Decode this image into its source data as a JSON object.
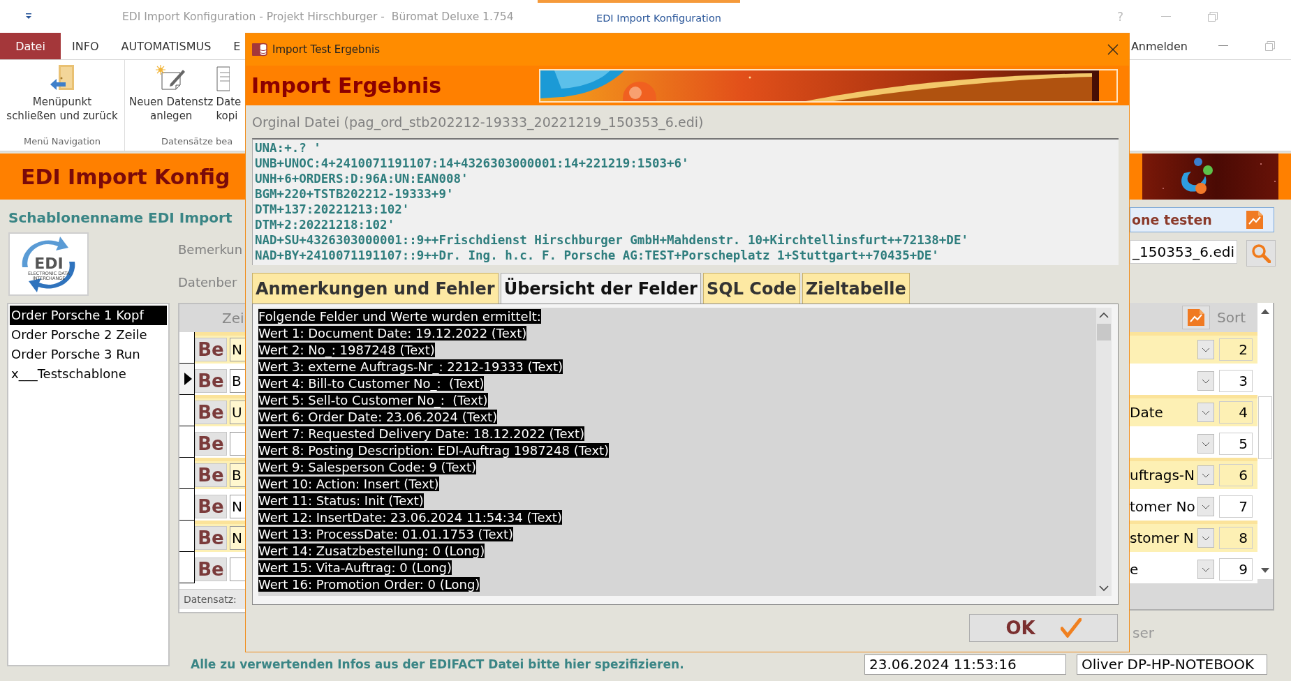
{
  "app": {
    "title": "EDI Import Konfiguration - Projekt Hirschburger -  Büromat Deluxe 1.754",
    "context_tab": "EDI Import Konfiguration",
    "help": "?",
    "menu": [
      {
        "label": "Datei",
        "selected": true
      },
      {
        "label": "INFO",
        "selected": false
      },
      {
        "label": "AUTOMATISMUS",
        "selected": false
      },
      {
        "label": "E",
        "selected": false
      }
    ],
    "account": "Anmelden",
    "ribbon_groups": [
      {
        "label": "Menü Navigation",
        "buttons": [
          {
            "kind": "back",
            "lines": [
              "Menüpunkt",
              "schließen und zurück"
            ]
          }
        ]
      },
      {
        "label": "Datensätze bea",
        "buttons": [
          {
            "kind": "new",
            "lines": [
              "Neuen Datenstz",
              "anlegen"
            ]
          },
          {
            "kind": "copy",
            "lines": [
              "Date",
              "kopi"
            ]
          }
        ]
      }
    ],
    "header": "EDI Import Konfig",
    "template_label": "Schablonenname EDI Import",
    "test_button": "one testen",
    "logo": {
      "text": "EDI",
      "subtitle": [
        "ELECTRONIC DATA",
        "INTERCHANGE"
      ]
    },
    "templates": [
      {
        "label": "Order Porsche 1 Kopf",
        "selected": true
      },
      {
        "label": "Order Porsche 2 Zeile",
        "selected": false
      },
      {
        "label": "Order Porsche 3 Run",
        "selected": false
      },
      {
        "label": "x___Testschablone",
        "selected": false
      }
    ],
    "field_labels": [
      "Bemerkun",
      "Datenber"
    ],
    "file_field": "_150353_6.edi",
    "grid": {
      "column_1": "Zei",
      "sort_header": "Sort",
      "navigation": "Datensatz:",
      "rows": [
        {
          "button": "Be",
          "field": "N",
          "sort": "2",
          "shaded": true,
          "current": false
        },
        {
          "button": "Be",
          "field": "B",
          "sort": "3",
          "shaded": false,
          "current": true
        },
        {
          "button": "Be",
          "field": "U",
          "combo": "Date",
          "sort": "4",
          "shaded": true,
          "current": false
        },
        {
          "button": "Be",
          "sort": "5",
          "shaded": false,
          "current": false
        },
        {
          "button": "Be",
          "field": "B",
          "combo": "uftrags-N",
          "sort": "6",
          "shaded": true,
          "current": false
        },
        {
          "button": "Be",
          "field": "N",
          "combo": "tomer No",
          "sort": "7",
          "shaded": false,
          "current": false
        },
        {
          "button": "Be",
          "field": "N",
          "combo": "stomer N",
          "sort": "8",
          "shaded": true,
          "current": false
        },
        {
          "button": "Be",
          "combo": "e",
          "sort": "9",
          "shaded": false,
          "current": false
        }
      ]
    },
    "user_label": "ser",
    "status_text": "Alle zu verwertenden Infos aus der EDIFACT Datei bitte hier spezifizieren.",
    "date_field": "23.06.2024 11:53:16",
    "user_field": "Oliver DP-HP-NOTEBOOK"
  },
  "dialog": {
    "title": "Import Test Ergebnis",
    "heading": "Import Ergebnis",
    "file_caption": "Orginal Datei (pag_ord_stb202212-19333_20221219_150353_6.edi)",
    "edi_lines": [
      "UNA:+.? '",
      "UNB+UNOC:4+2410071191107:14+4326303000001:14+221219:1503+6'",
      "UNH+6+ORDERS:D:96A:UN:EAN008'",
      "BGM+220+TSTB202212-19333+9'",
      "DTM+137:20221213:102'",
      "DTM+2:20221218:102'",
      "NAD+SU+4326303000001::9++Frischdienst Hirschburger GmbH+Mahdenstr. 10+Kirchtellinsfurt++72138+DE'",
      "NAD+BY+2410071191107::9++Dr. Ing. h.c. F. Porsche AG:TEST+Porscheplatz 1+Stuttgart++70435+DE'"
    ],
    "tabs": [
      {
        "label": "Anmerkungen und Fehler",
        "selected": false
      },
      {
        "label": "Übersicht der Felder",
        "selected": true
      },
      {
        "label": "SQL Code",
        "selected": false
      },
      {
        "label": "Zieltabelle",
        "selected": false
      }
    ],
    "result_lines": [
      "Folgende Felder und Werte wurden ermittelt:",
      "Wert 1: Document Date: 19.12.2022 (Text)",
      "Wert 2: No_: 1987248 (Text)",
      "Wert 3: externe Auftrags-Nr_: 2212-19333 (Text)",
      "Wert 4: Bill-to Customer No_:  (Text)",
      "Wert 5: Sell-to Customer No_:  (Text)",
      "Wert 6: Order Date: 23.06.2024 (Text)",
      "Wert 7: Requested Delivery Date: 18.12.2022 (Text)",
      "Wert 8: Posting Description: EDI-Auftrag 1987248 (Text)",
      "Wert 9: Salesperson Code: 9 (Text)",
      "Wert 10: Action: Insert (Text)",
      "Wert 11: Status: Init (Text)",
      "Wert 12: InsertDate: 23.06.2024 11:54:34 (Text)",
      "Wert 13: ProcessDate: 01.01.1753 (Text)",
      "Wert 14: Zusatzbestellung: 0 (Long)",
      "Wert 15: Vita-Auftrag: 0 (Long)",
      "Wert 16: Promotion Order: 0 (Long)"
    ],
    "ok_button": "OK"
  }
}
